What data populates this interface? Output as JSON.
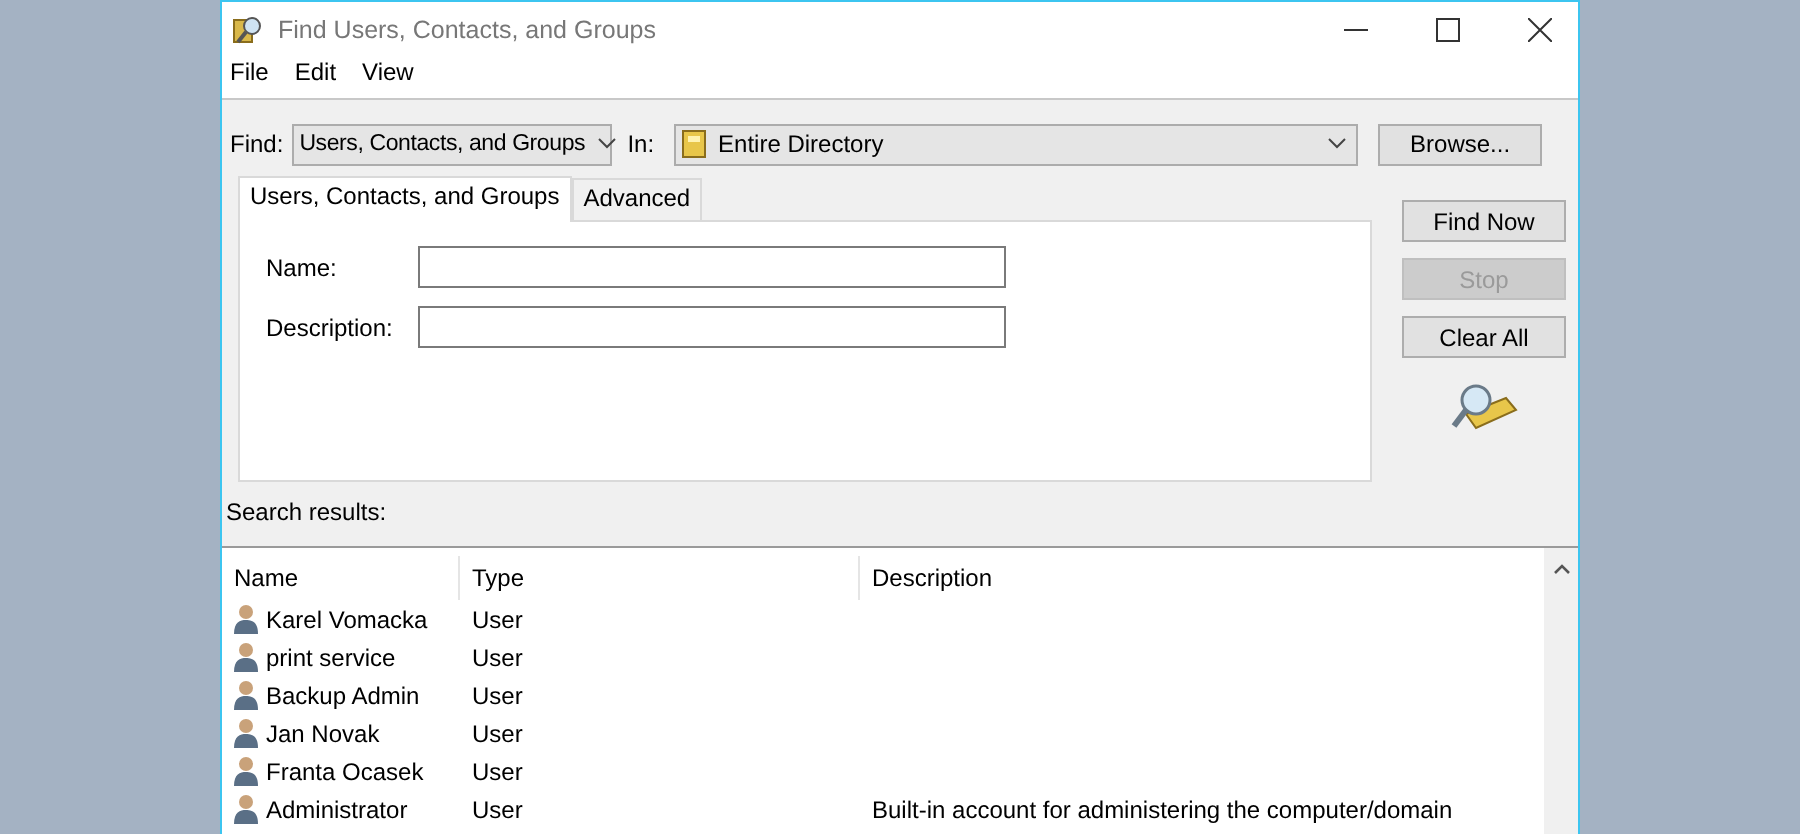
{
  "window": {
    "title": "Find Users, Contacts, and Groups"
  },
  "menu": [
    "File",
    "Edit",
    "View"
  ],
  "find": {
    "label": "Find:",
    "value": "Users, Contacts, and Groups"
  },
  "in": {
    "label": "In:",
    "value": "Entire Directory"
  },
  "browse_button": "Browse...",
  "tabs": [
    {
      "label": "Users, Contacts, and Groups",
      "selected": true
    },
    {
      "label": "Advanced",
      "selected": false
    }
  ],
  "fields": [
    {
      "label": "Name:"
    },
    {
      "label": "Description:"
    }
  ],
  "buttons": [
    {
      "label": "Find Now",
      "disabled": false
    },
    {
      "label": "Stop",
      "disabled": true
    },
    {
      "label": "Clear All",
      "disabled": false
    }
  ],
  "results_label": "Search results:",
  "table": {
    "columns": [
      "Name",
      "Type",
      "Description"
    ],
    "rows": [
      {
        "name": "Karel Vomacka",
        "type": "User",
        "description": ""
      },
      {
        "name": "print service",
        "type": "User",
        "description": ""
      },
      {
        "name": "Backup Admin",
        "type": "User",
        "description": ""
      },
      {
        "name": "Jan Novak",
        "type": "User",
        "description": ""
      },
      {
        "name": "Franta Ocasek",
        "type": "User",
        "description": ""
      },
      {
        "name": "Administrator",
        "type": "User",
        "description": "Built-in account for administering the computer/domain"
      }
    ]
  }
}
